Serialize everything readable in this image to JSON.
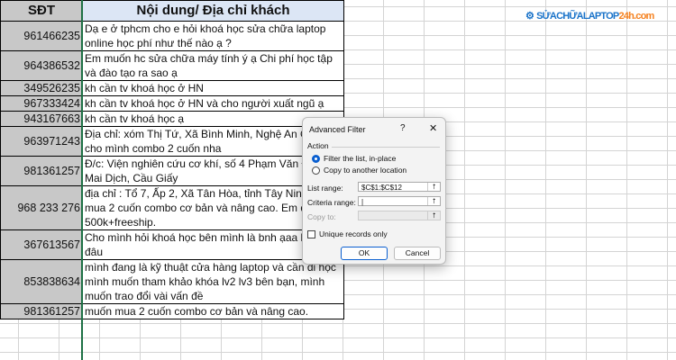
{
  "sheet": {
    "headers": [
      "SĐT",
      "Nội dung/ Địa chỉ khách"
    ],
    "rows": [
      {
        "phone": "961466235",
        "content": "Dạ e ở tphcm cho e hỏi khoá học sửa chữa laptop online học phí như thế nào ạ ?"
      },
      {
        "phone": "964386532",
        "content": "Em muốn hc sửa chữa máy tính ý ạ Chi phí học tập và đào tạo ra sao ạ"
      },
      {
        "phone": "349526235",
        "content": "kh cần tv khoá học ở HN"
      },
      {
        "phone": "967333424",
        "content": "kh cần tv khoá học ở HN và cho người xuất ngũ ạ"
      },
      {
        "phone": "943167663",
        "content": "kh cần tv khoá học ạ"
      },
      {
        "phone": "963971243",
        "content": "Địa chỉ: xóm Thị Tứ, Xã Bình Minh, Nghệ An Gửi về cho mình combo 2 cuốn nha"
      },
      {
        "phone": "981361257",
        "content": "Đ/c: Viện nghiên cứu cơ khí, số 4 Phạm Văn Đồng, p Mai Dịch, Cầu Giấy"
      },
      {
        "phone": "968 233 276",
        "content": "địa chỉ : Tổ 7, Ấp 2, Xã Tân Hòa, tỉnh Tây Ninh muốn mua 2 cuốn combo cơ bản và nâng cao. Em để giá 500k+freeship."
      },
      {
        "phone": "367613567",
        "content": "Cho mình hỏi khoá học bên mình là bnh ạaa kh ở đâu"
      },
      {
        "phone": "853838634",
        "content": "mình đang là kỹ thuật cửa hàng laptop và cần đi học mình muốn tham khảo khóa lv2 lv3 bên bạn, mình muốn trao đổi vài vấn đề"
      },
      {
        "phone": "981361257",
        "content": "muốn mua 2 cuốn combo cơ bản và nâng cao."
      }
    ]
  },
  "logo": {
    "part1": "SỬACHỮALAPTOP",
    "part2": "24h.com"
  },
  "dialog": {
    "title": "Advanced Filter",
    "help": "?",
    "close": "✕",
    "action_label": "Action",
    "options": [
      "Filter the list, in-place",
      "Copy to another location"
    ],
    "list_range_label": "List range:",
    "list_range_value": "$C$1:$C$12",
    "criteria_label": "Criteria range:",
    "criteria_value": "|",
    "copy_to_label": "Copy to:",
    "unique_label": "Unique records only",
    "ok": "OK",
    "cancel": "Cancel"
  }
}
